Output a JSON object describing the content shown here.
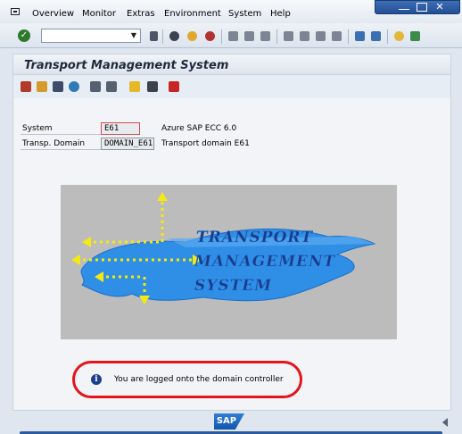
{
  "menu": {
    "items": [
      "Overview",
      "Monitor",
      "Extras",
      "Environment",
      "System",
      "Help"
    ]
  },
  "toolbar": {
    "command_field_value": ""
  },
  "page": {
    "title": "Transport Management System"
  },
  "fields": {
    "system": {
      "label": "System",
      "value": "E61",
      "description": "Azure SAP ECC 6.0"
    },
    "domain": {
      "label": "Transp. Domain",
      "value": "DOMAIN_E61",
      "description": "Transport domain E61"
    }
  },
  "logo": {
    "line1": "TRANSPORT",
    "line2": "MANAGEMENT",
    "line3": "SYSTEM"
  },
  "message": {
    "text": "You are logged onto the domain controller",
    "highlight_color": "#e3141b"
  },
  "footer": {
    "brand": "SAP"
  },
  "colors": {
    "accent": "#2c5a9f",
    "logo_blue": "#2f8ee6",
    "arrow_yellow": "#f4ea10"
  }
}
